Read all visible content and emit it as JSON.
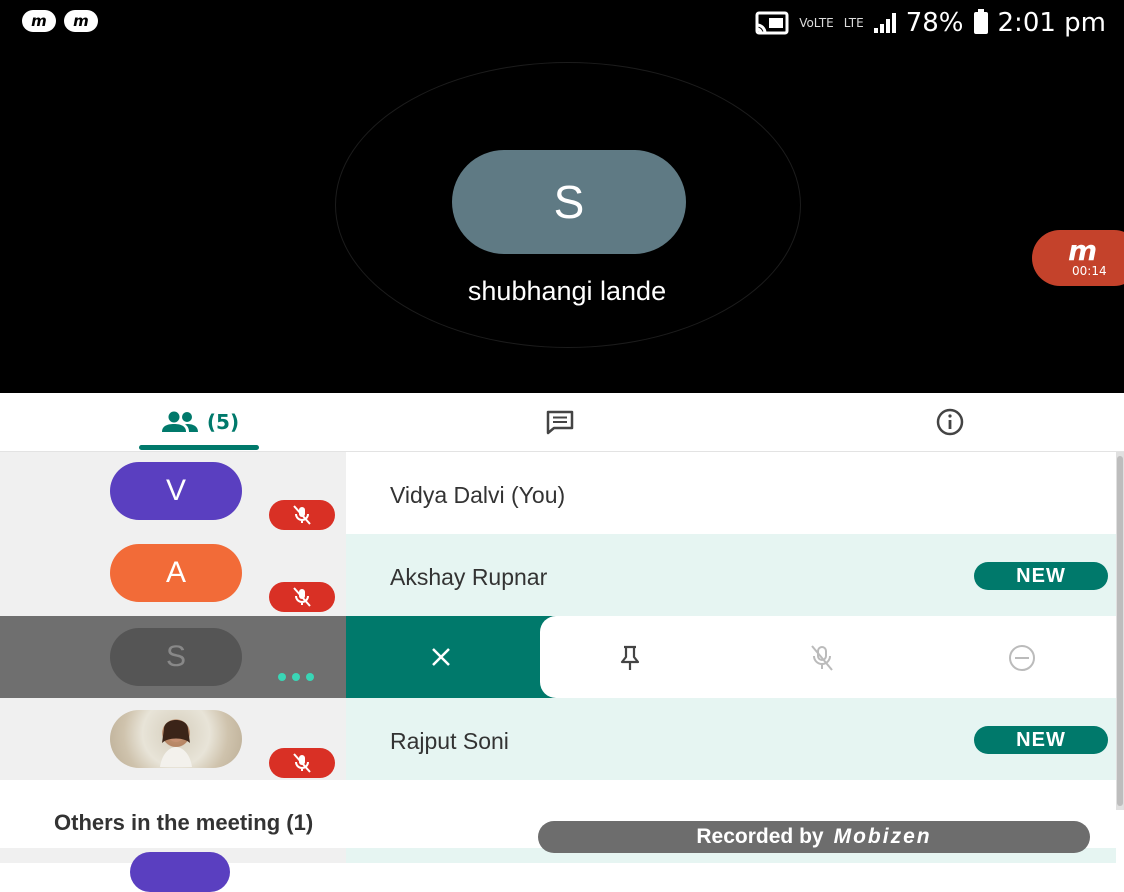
{
  "status_bar": {
    "badges": [
      "m",
      "m"
    ],
    "volte": "VoLTE",
    "lte": "LTE",
    "battery": "78%",
    "time": "2:01 pm"
  },
  "speaker": {
    "initial": "S",
    "name": "shubhangi lande"
  },
  "mobizen": {
    "logo": "m",
    "timer": "00:14"
  },
  "tabs": {
    "people_count": "(5)"
  },
  "participants": [
    {
      "initial": "V",
      "name": "Vidya Dalvi (You)",
      "color": "#5a3fc0"
    },
    {
      "initial": "A",
      "name": "Akshay Rupnar",
      "badge": "NEW",
      "color": "#f26b38"
    },
    {
      "initial": "S",
      "color": "#555555"
    },
    {
      "name": "Rajput Soni",
      "badge": "NEW"
    }
  ],
  "others_heading": "Others in the meeting (1)",
  "recording": {
    "label": "Recorded by",
    "brand": "Mobizen"
  }
}
